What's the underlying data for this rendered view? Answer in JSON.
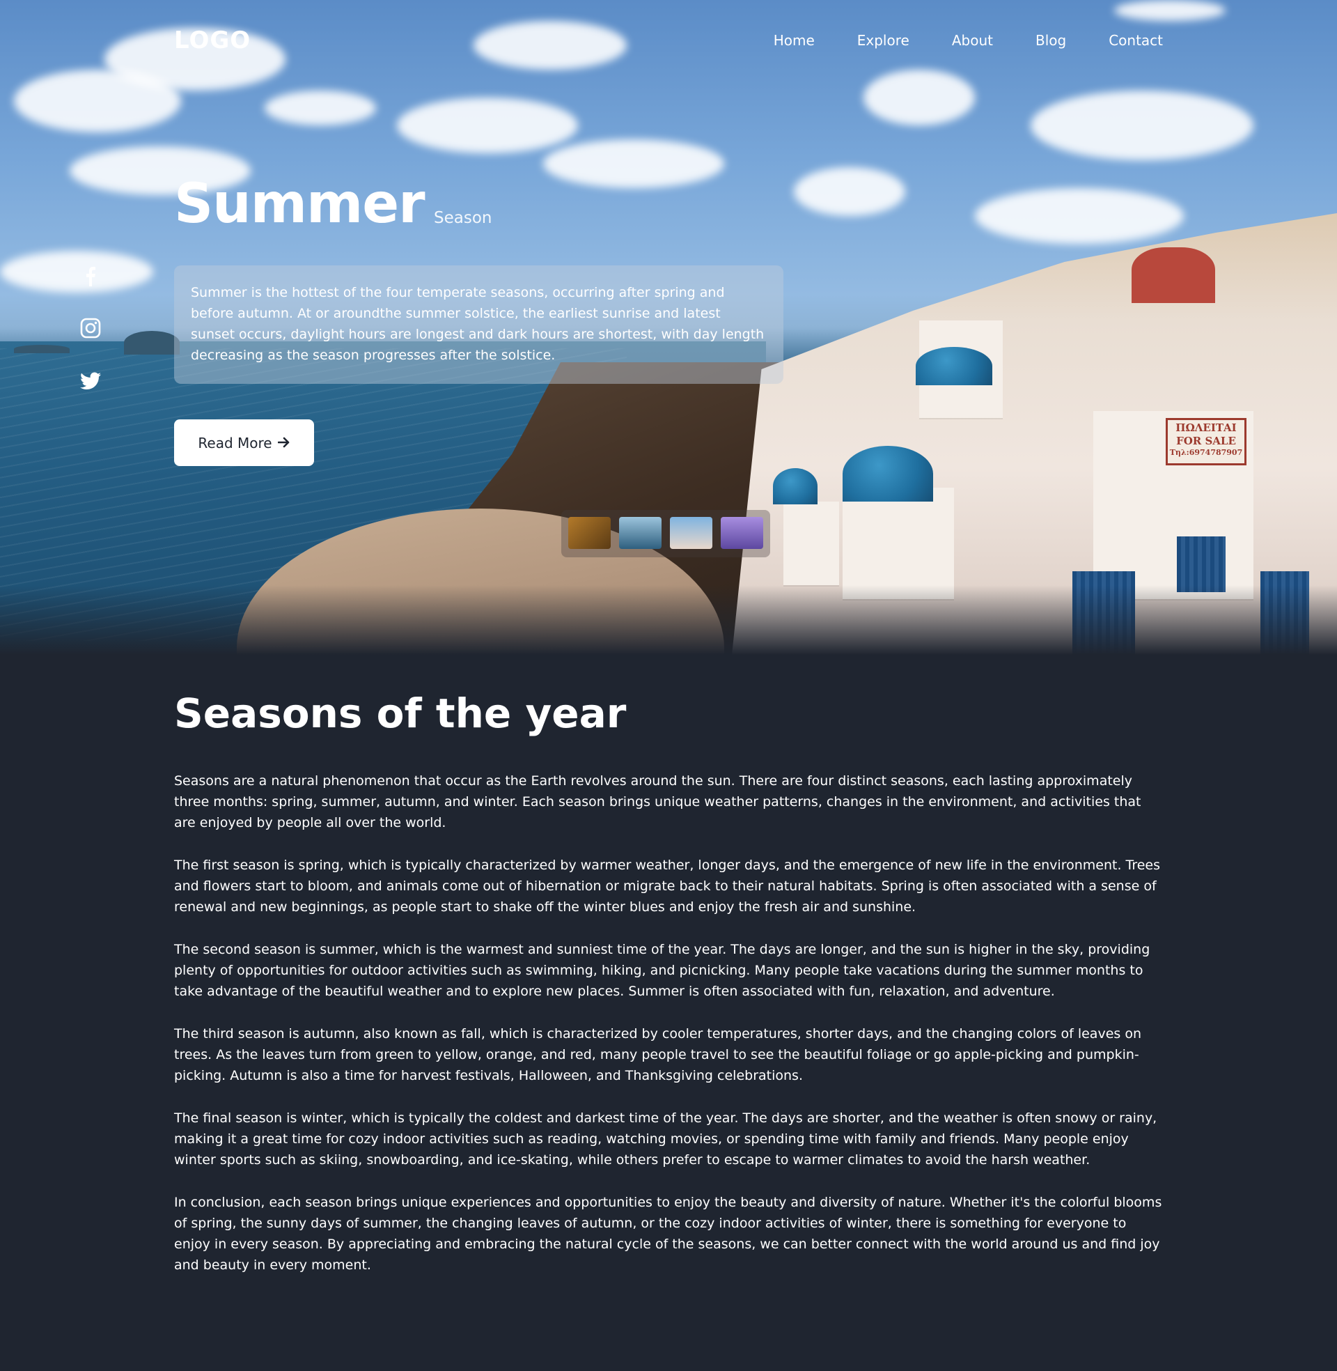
{
  "header": {
    "logo": "LOGO",
    "nav": [
      "Home",
      "Explore",
      "About",
      "Blog",
      "Contact"
    ]
  },
  "social": [
    "facebook-icon",
    "instagram-icon",
    "twitter-icon"
  ],
  "hero": {
    "title": "Summer",
    "subtitle": "Season",
    "description": "Summer is the hottest of the four temperate seasons, occurring after spring and before autumn. At or aroundthe summer solstice, the earliest sunrise and latest sunset occurs, daylight hours are longest and dark hours are shortest, with day length decreasing as the season progresses after the solstice.",
    "read_more_label": "Read More",
    "sign_lines": [
      "ΠΩΛΕΙΤΑΙ",
      "FOR SALE",
      "Τηλ:6974787907"
    ]
  },
  "thumbnails": [
    {
      "name": "autumn-thumbnail",
      "color": "#8a5a22"
    },
    {
      "name": "winter-thumbnail",
      "color": "#4f86a6"
    },
    {
      "name": "summer-thumbnail",
      "color": "#6ea9d6"
    },
    {
      "name": "spring-thumbnail",
      "color": "#8a6fc4"
    }
  ],
  "content": {
    "title": "Seasons of the year",
    "paragraphs": [
      "Seasons are a natural phenomenon that occur as the Earth revolves around the sun. There are four distinct seasons, each lasting approximately three months: spring, summer, autumn, and winter. Each season brings unique weather patterns, changes in the environment, and activities that are enjoyed by people all over the world.",
      "The first season is spring, which is typically characterized by warmer weather, longer days, and the emergence of new life in the environment. Trees and flowers start to bloom, and animals come out of hibernation or migrate back to their natural habitats. Spring is often associated with a sense of renewal and new beginnings, as people start to shake off the winter blues and enjoy the fresh air and sunshine.",
      "The second season is summer, which is the warmest and sunniest time of the year. The days are longer, and the sun is higher in the sky, providing plenty of opportunities for outdoor activities such as swimming, hiking, and picnicking. Many people take vacations during the summer months to take advantage of the beautiful weather and to explore new places. Summer is often associated with fun, relaxation, and adventure.",
      "The third season is autumn, also known as fall, which is characterized by cooler temperatures, shorter days, and the changing colors of leaves on trees. As the leaves turn from green to yellow, orange, and red, many people travel to see the beautiful foliage or go apple-picking and pumpkin-picking. Autumn is also a time for harvest festivals, Halloween, and Thanksgiving celebrations.",
      "The final season is winter, which is typically the coldest and darkest time of the year. The days are shorter, and the weather is often snowy or rainy, making it a great time for cozy indoor activities such as reading, watching movies, or spending time with family and friends. Many people enjoy winter sports such as skiing, snowboarding, and ice-skating, while others prefer to escape to warmer climates to avoid the harsh weather.",
      "In conclusion, each season brings unique experiences and opportunities to enjoy the beauty and diversity of nature. Whether it's the colorful blooms of spring, the sunny days of summer, the changing leaves of autumn, or the cozy indoor activities of winter, there is something for everyone to enjoy in every season. By appreciating and embracing the natural cycle of the seasons, we can better connect with the world around us and find joy and beauty in every moment."
    ]
  }
}
